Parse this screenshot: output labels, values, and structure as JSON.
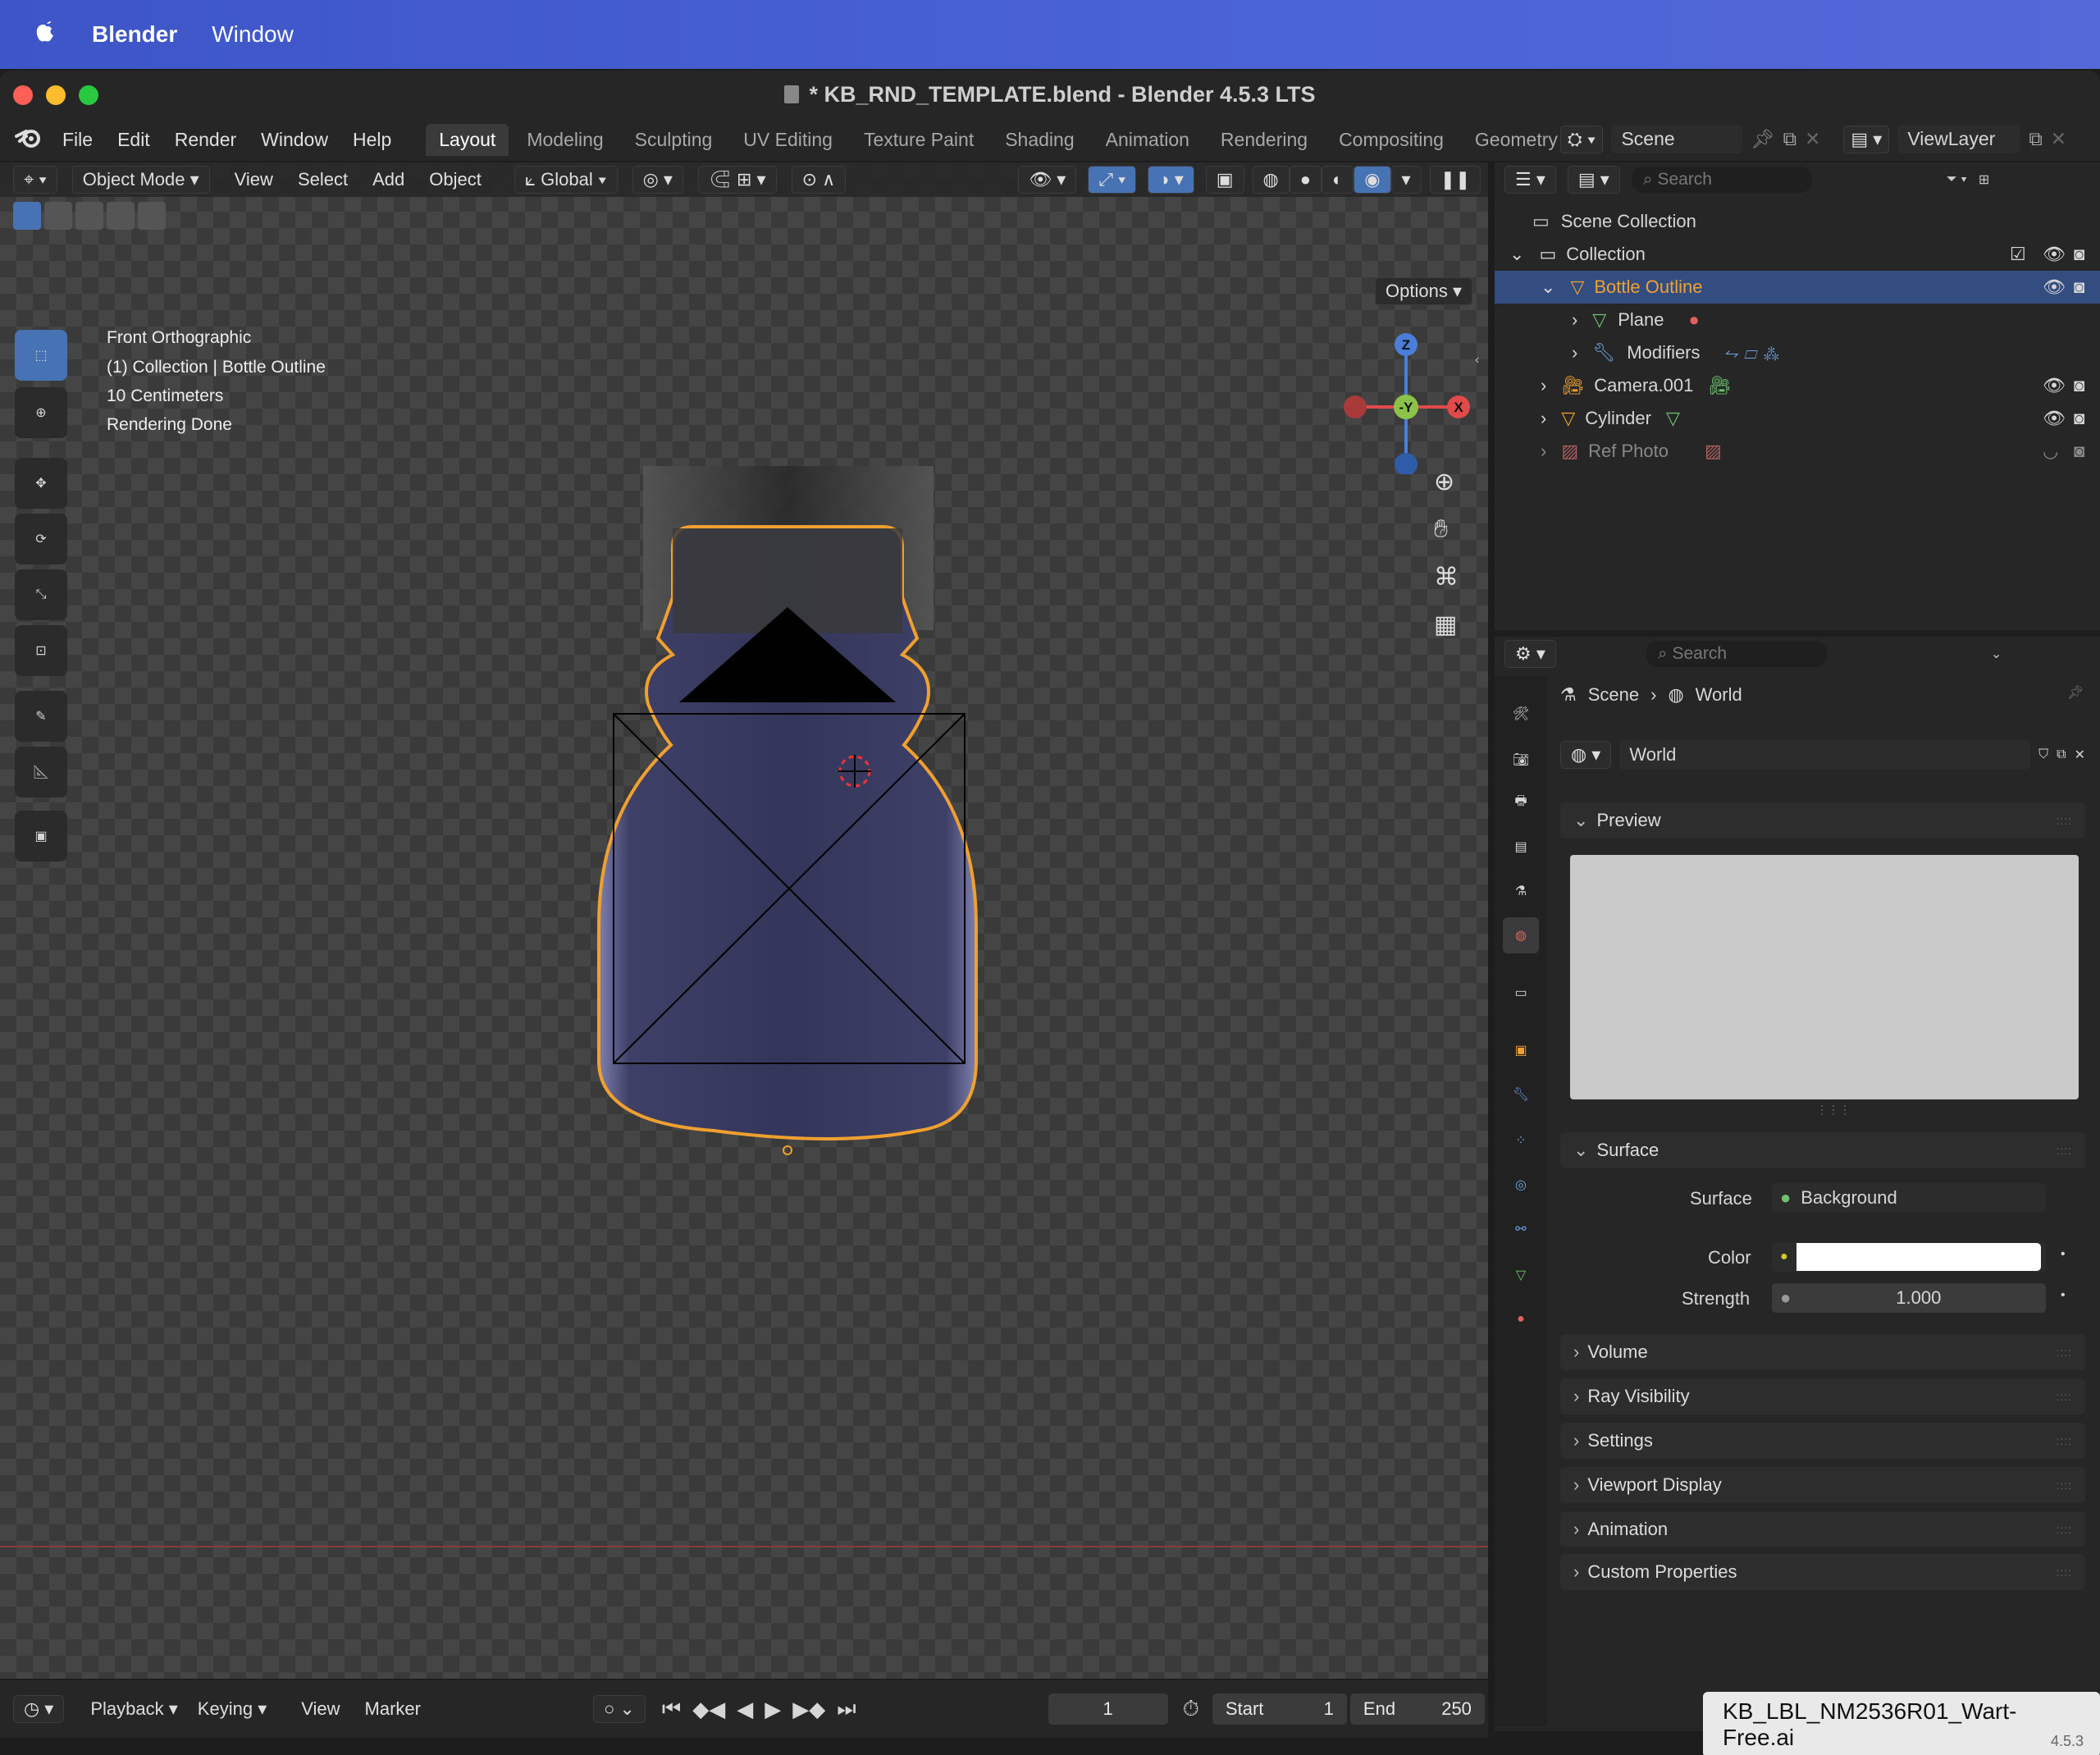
{
  "mac_menu": {
    "app": "Blender",
    "window": "Window"
  },
  "window_title": "* KB_RND_TEMPLATE.blend - Blender 4.5.3 LTS",
  "menu": [
    "File",
    "Edit",
    "Render",
    "Window",
    "Help"
  ],
  "workspaces": [
    "Layout",
    "Modeling",
    "Sculpting",
    "UV Editing",
    "Texture Paint",
    "Shading",
    "Animation",
    "Rendering",
    "Compositing",
    "Geometry"
  ],
  "scene_name": "Scene",
  "view_layer": "ViewLayer",
  "viewport_header": {
    "mode": "Object Mode",
    "view": "View",
    "select": "Select",
    "add": "Add",
    "object": "Object",
    "orientation": "Global",
    "options": "Options"
  },
  "overlay": {
    "view_name": "Front Orthographic",
    "collection": "(1) Collection | Bottle Outline",
    "scale": "10 Centimeters",
    "status": "Rendering Done"
  },
  "gizmo": {
    "z": "Z",
    "y": "-Y",
    "x": "X"
  },
  "outliner": {
    "search": "Search",
    "root": "Scene Collection",
    "collection": "Collection",
    "items": [
      "Bottle Outline",
      "Plane",
      "Modifiers",
      "Camera.001",
      "Cylinder",
      "Ref Photo"
    ]
  },
  "properties": {
    "search": "Search",
    "breadcrumb_scene": "Scene",
    "breadcrumb_world": "World",
    "world_name": "World",
    "preview": "Preview",
    "surface_section": "Surface",
    "surface_label": "Surface",
    "surface_value": "Background",
    "color_label": "Color",
    "strength_label": "Strength",
    "strength_value": "1.000",
    "sections": [
      "Volume",
      "Ray Visibility",
      "Settings",
      "Viewport Display",
      "Animation",
      "Custom Properties"
    ]
  },
  "timeline": {
    "playback": "Playback",
    "keying": "Keying",
    "view": "View",
    "marker": "Marker",
    "current_frame": "1",
    "start_label": "Start",
    "start": "1",
    "end_label": "End",
    "end": "250"
  },
  "tooltip": "KB_LBL_NM2536R01_Wart-Free.ai",
  "version_corner": "4.5.3",
  "colors": {
    "accent": "#4772b3",
    "selection_orange": "#f0a030",
    "mac_bar": "#4a63d6"
  }
}
